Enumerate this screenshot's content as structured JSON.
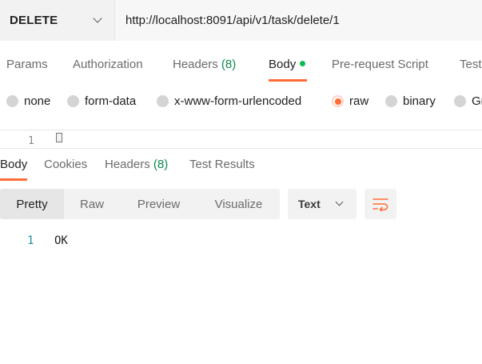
{
  "request": {
    "method": "DELETE",
    "url": "http://localhost:8091/api/v1/task/delete/1"
  },
  "request_tabs": {
    "params": "Params",
    "authorization": "Authorization",
    "headers": "Headers",
    "headers_count": "(8)",
    "body": "Body",
    "prerequest": "Pre-request Script",
    "tests": "Tests"
  },
  "body_types": {
    "none": "none",
    "form_data": "form-data",
    "urlencoded": "x-www-form-urlencoded",
    "raw": "raw",
    "binary": "binary",
    "graphql": "GraphQL",
    "selected": "raw"
  },
  "editor": {
    "line_number": "1"
  },
  "response_tabs": {
    "body": "Body",
    "cookies": "Cookies",
    "headers": "Headers",
    "headers_count": "(8)",
    "test_results": "Test Results"
  },
  "response_view": {
    "pretty": "Pretty",
    "raw": "Raw",
    "preview": "Preview",
    "visualize": "Visualize",
    "format": "Text"
  },
  "response_body": {
    "lines": [
      {
        "number": "1",
        "text": "OK"
      }
    ]
  },
  "colors": {
    "accent": "#ff6c37",
    "status_green": "#0cbb52",
    "count_green": "#0a8a4b",
    "line_number": "#1d8ea5"
  },
  "icons": {
    "method_dropdown": "chevron-down-icon",
    "body_modified": "dot-icon",
    "format_dropdown": "chevron-down-icon",
    "wrap": "wrap-lines-icon"
  }
}
